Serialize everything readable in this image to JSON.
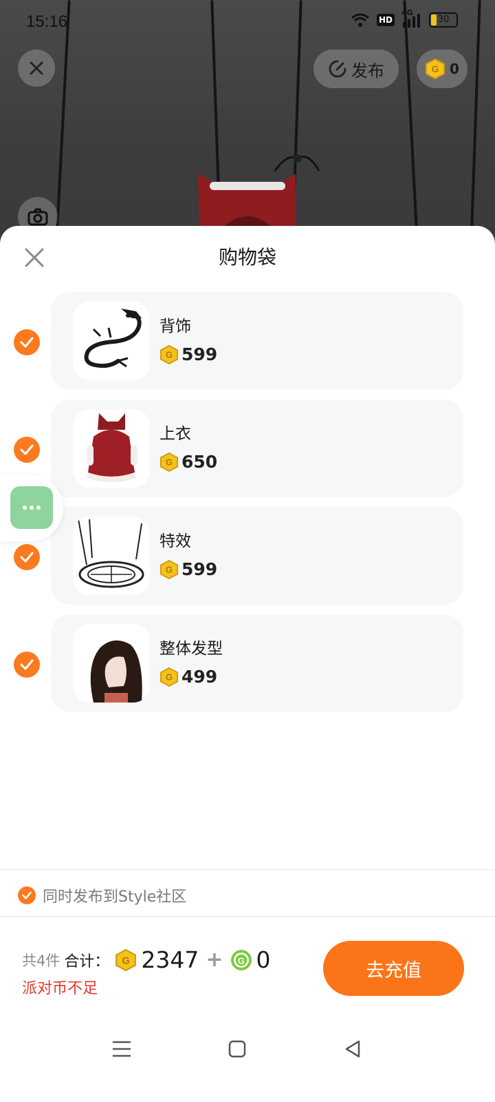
{
  "status_bar": {
    "time": "15:16",
    "network_label": "4G",
    "hd_label": "HD",
    "battery": "30"
  },
  "top_bar": {
    "publish_label": "发布",
    "coin_balance": "0"
  },
  "sheet": {
    "title": "购物袋",
    "items": [
      {
        "name": "背饰",
        "price": "599",
        "thumb_icon": "dragon-backpiece-icon"
      },
      {
        "name": "上衣",
        "price": "650",
        "thumb_icon": "red-hooded-outfit-icon"
      },
      {
        "name": "特效",
        "price": "599",
        "thumb_icon": "magic-circle-effect-icon"
      },
      {
        "name": "整体发型",
        "price": "499",
        "thumb_icon": "long-hair-icon"
      }
    ],
    "share_label": "同时发布到Style社区"
  },
  "footer": {
    "count_label": "共4件",
    "total_label": "合计：",
    "party_coin_total": "2347",
    "plus": "+",
    "green_coin_total": "0",
    "warning": "派对币不足",
    "recharge_label": "去充值"
  },
  "colors": {
    "accent_orange": "#fb7a1f",
    "warning_red": "#e53a2a",
    "coin_gold": "#f3c21c",
    "coin_green": "#7cc93f",
    "float_green": "#8fd49e"
  }
}
